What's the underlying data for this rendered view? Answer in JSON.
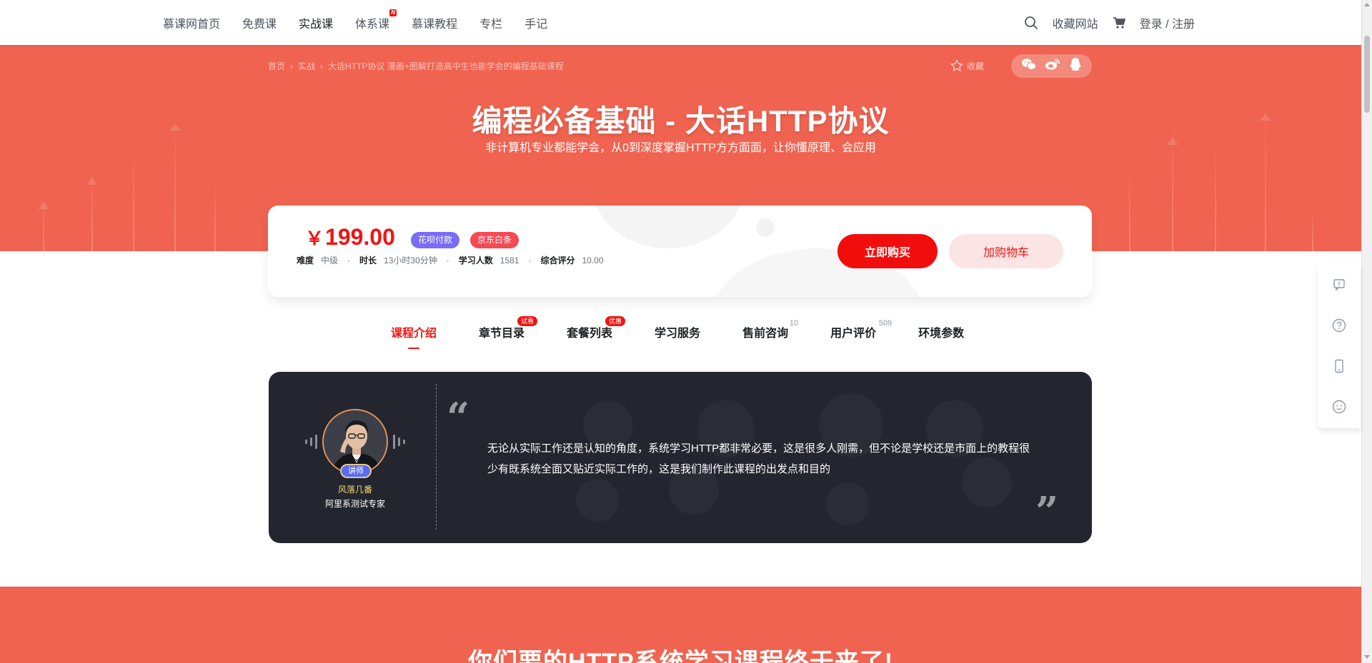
{
  "header": {
    "nav": [
      {
        "label": "慕课网首页",
        "active": false
      },
      {
        "label": "免费课",
        "active": false
      },
      {
        "label": "实战课",
        "active": true
      },
      {
        "label": "体系课",
        "active": false,
        "badge": "N"
      },
      {
        "label": "慕课教程",
        "active": false
      },
      {
        "label": "专栏",
        "active": false
      },
      {
        "label": "手记",
        "active": false
      }
    ],
    "favorite_site": "收藏网站",
    "login": "登录 / 注册",
    "icons": [
      "search-icon",
      "cart-icon"
    ]
  },
  "hero": {
    "breadcrumb": [
      "首页",
      "实战",
      "大话HTTP协议 漫画+图解打造高中生也能学会的编程基础课程"
    ],
    "collect_label": "收藏",
    "share_icons": [
      "wechat-icon",
      "weibo-icon",
      "qq-icon"
    ],
    "title": "编程必备基础 - 大话HTTP协议",
    "subtitle": "非计算机专业都能学会，从0到深度掌握HTTP方方面面，让你懂原理、会应用"
  },
  "course_info": {
    "currency": "￥",
    "price": "199.00",
    "tags": [
      "花呗付款",
      "京东白条"
    ],
    "meta": [
      {
        "key": "难度",
        "value": "中级"
      },
      {
        "key": "时长",
        "value": "13小时30分钟"
      },
      {
        "key": "学习人数",
        "value": "1581"
      },
      {
        "key": "综合评分",
        "value": "10.00"
      }
    ],
    "buy_label": "立即购买",
    "cart_label": "加购物车",
    "colors": {
      "accent": "#f01414",
      "hero": "#f06350"
    }
  },
  "tabs": [
    {
      "label": "课程介绍",
      "active": true
    },
    {
      "label": "章节目录",
      "mark": "试看"
    },
    {
      "label": "套餐列表",
      "mark": "优惠"
    },
    {
      "label": "学习服务"
    },
    {
      "label": "售前咨询",
      "count": "10"
    },
    {
      "label": "用户评价",
      "count": "509"
    },
    {
      "label": "环境参数"
    }
  ],
  "teacher": {
    "badge": "讲师",
    "name": "风落几番",
    "title": "阿里系测试专家",
    "quote": "无论从实际工作还是认知的角度，系统学习HTTP都非常必要，这是很多人刚需，但不论是学校还是市面上的教程很少有既系统全面又贴近实际工作的，这是我们制作此课程的出发点和目的"
  },
  "section_title": "你们要的HTTP系统学习课程终于来了!",
  "sidebar_icons": [
    "feedback-icon",
    "help-icon",
    "mobile-icon",
    "smile-icon"
  ]
}
